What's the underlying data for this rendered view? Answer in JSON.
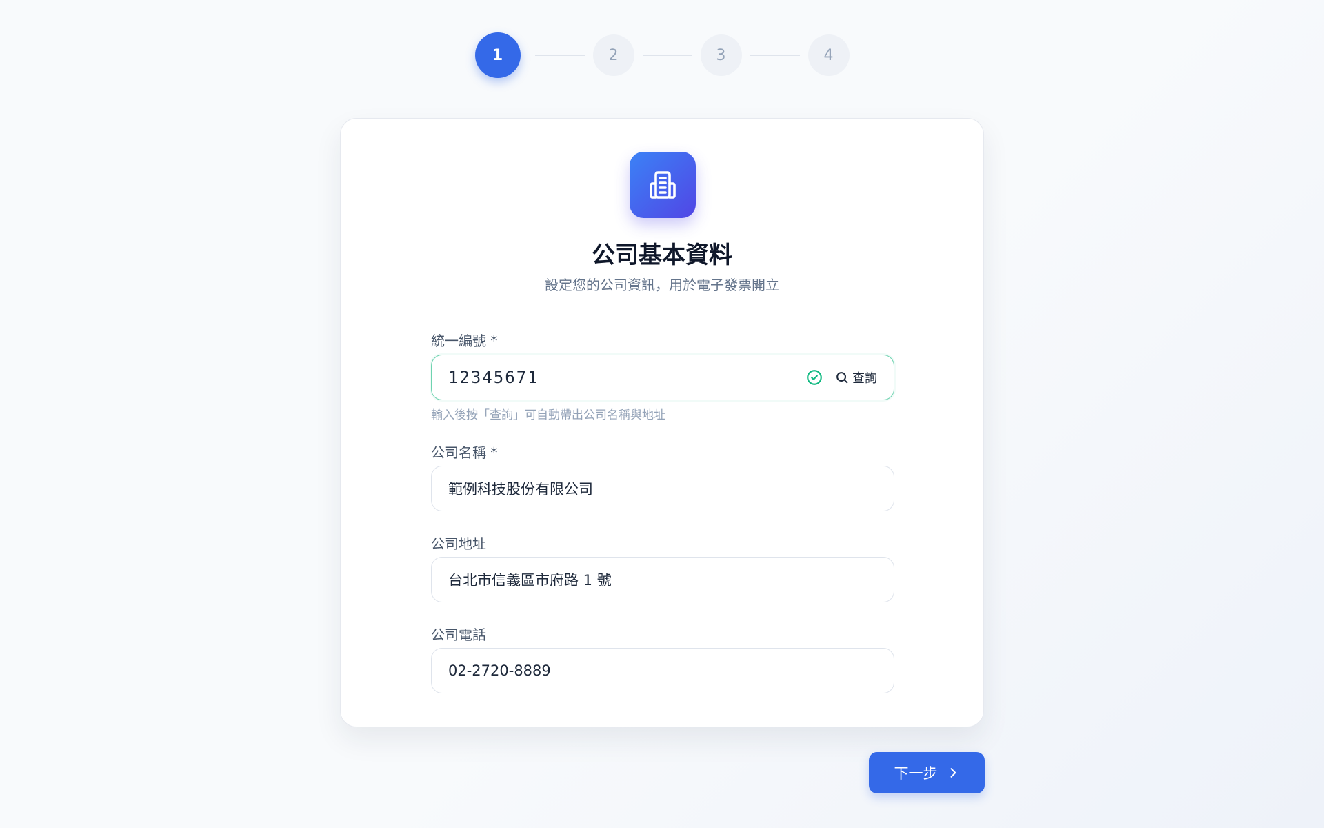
{
  "stepper": {
    "steps": [
      {
        "label": "1",
        "state": "active"
      },
      {
        "label": "2",
        "state": "pending"
      },
      {
        "label": "3",
        "state": "pending"
      },
      {
        "label": "4",
        "state": "pending"
      }
    ]
  },
  "card": {
    "icon": "building-icon",
    "title": "公司基本資料",
    "subtitle": "設定您的公司資訊，用於電子發票開立"
  },
  "fields": {
    "tax_id": {
      "label": "統一編號 *",
      "value": "12345671",
      "status_icon": "check-circle-icon",
      "lookup_label": "查詢",
      "hint": "輸入後按「查詢」可自動帶出公司名稱與地址"
    },
    "company_name": {
      "label": "公司名稱 *",
      "value": "範例科技股份有限公司"
    },
    "company_address": {
      "label": "公司地址",
      "value": "台北市信義區市府路 1 號"
    },
    "company_phone": {
      "label": "公司電話",
      "value": "02-2720-8889"
    }
  },
  "actions": {
    "next_label": "下一步",
    "next_icon": "chevron-right-icon"
  },
  "colors": {
    "primary": "#3469e8",
    "success": "#10b981",
    "icon_gradient_start": "#3b82f6",
    "icon_gradient_end": "#5146e5"
  }
}
